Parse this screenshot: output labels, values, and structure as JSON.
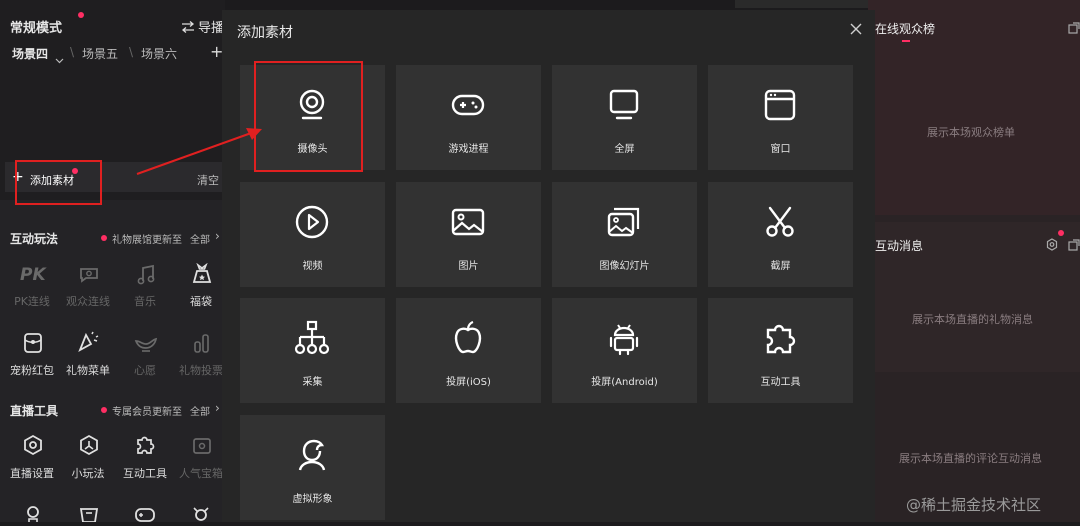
{
  "left_panel": {
    "mode_label": "常规模式",
    "guide_label": "导播",
    "scenes": [
      "场景四",
      "场景五",
      "场景六"
    ],
    "add_material_label": "添加素材",
    "clear_label": "清空",
    "interactive": {
      "title": "互动玩法",
      "notice": "礼物展馆更新至",
      "all_label": "全部",
      "items": [
        "PK连线",
        "观众连线",
        "音乐",
        "福袋",
        "宠粉红包",
        "礼物菜单",
        "心愿",
        "礼物投票"
      ]
    },
    "live_tools": {
      "title": "直播工具",
      "notice": "专属会员更新至",
      "all_label": "全部",
      "items": [
        "直播设置",
        "小玩法",
        "互动工具",
        "人气宝箱"
      ]
    }
  },
  "right_panel": {
    "audience_title": "在线观众榜",
    "audience_placeholder": "展示本场观众榜单",
    "messages_title": "互动消息",
    "gift_placeholder": "展示本场直播的礼物消息",
    "comment_placeholder": "展示本场直播的评论互动消息",
    "watermark": "@稀土掘金技术社区"
  },
  "modal": {
    "title": "添加素材",
    "tiles": [
      {
        "label": "摄像头",
        "icon": "camera-icon"
      },
      {
        "label": "游戏进程",
        "icon": "gamepad-icon"
      },
      {
        "label": "全屏",
        "icon": "monitor-icon"
      },
      {
        "label": "窗口",
        "icon": "window-icon"
      },
      {
        "label": "视频",
        "icon": "play-icon"
      },
      {
        "label": "图片",
        "icon": "image-icon"
      },
      {
        "label": "图像幻灯片",
        "icon": "slideshow-icon"
      },
      {
        "label": "截屏",
        "icon": "scissors-icon"
      },
      {
        "label": "采集",
        "icon": "capture-icon"
      },
      {
        "label": "投屏(iOS)",
        "icon": "apple-icon"
      },
      {
        "label": "投屏(Android)",
        "icon": "android-icon"
      },
      {
        "label": "互动工具",
        "icon": "puzzle-icon"
      },
      {
        "label": "虚拟形象",
        "icon": "avatar-icon"
      }
    ]
  },
  "colors": {
    "accent": "#ff2e63",
    "highlight": "#e02020"
  }
}
